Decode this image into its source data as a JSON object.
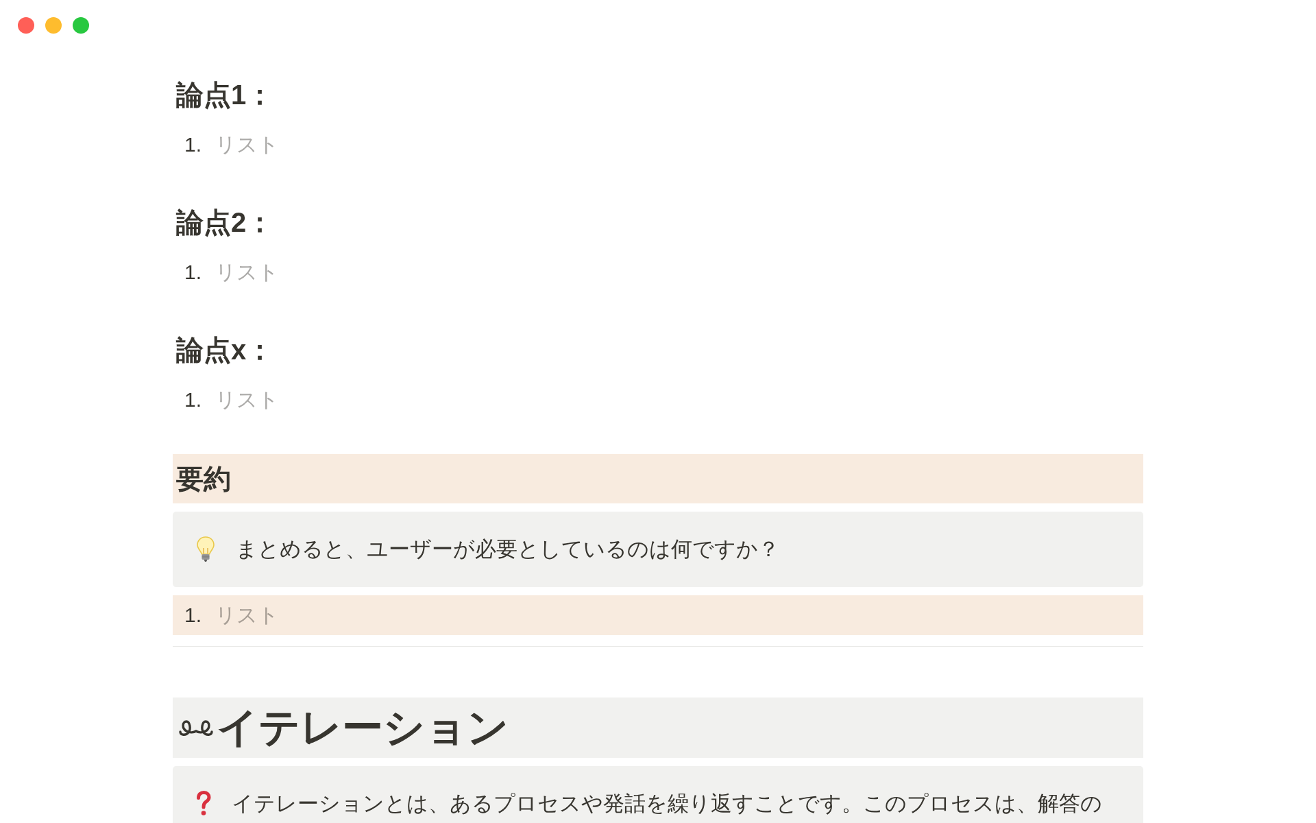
{
  "window": {
    "controls": [
      {
        "kind": "close"
      },
      {
        "kind": "minimize"
      },
      {
        "kind": "zoom"
      }
    ]
  },
  "blocks": [
    {
      "kind": "h2",
      "text": "論点1："
    },
    {
      "kind": "list",
      "number": "1.",
      "placeholder": "リスト"
    },
    {
      "kind": "h2",
      "text": "論点2："
    },
    {
      "kind": "list",
      "number": "1.",
      "placeholder": "リスト"
    },
    {
      "kind": "h2",
      "text": "論点x："
    },
    {
      "kind": "list",
      "number": "1.",
      "placeholder": "リスト"
    },
    {
      "kind": "h2",
      "text": "要約",
      "color": "#f8ebdf"
    },
    {
      "kind": "callout",
      "icon": {
        "kind": "bulb"
      },
      "text": "まとめると、ユーザーが必要としているのは何ですか？",
      "color": "#f1f1ef"
    },
    {
      "kind": "list",
      "number": "1.",
      "placeholder": "リスト",
      "color": "#f8ebdf"
    },
    {
      "kind": "divider"
    },
    {
      "kind": "h1",
      "icon": {
        "kind": "loop"
      },
      "text": "イテレーション",
      "color": "#f1f1ef"
    },
    {
      "kind": "callout",
      "icon": {
        "kind": "question"
      },
      "text": "イテレーションとは、あるプロセスや発話を繰り返すことです。このプロセスは、解答の",
      "color": "#f1f1ef"
    }
  ]
}
